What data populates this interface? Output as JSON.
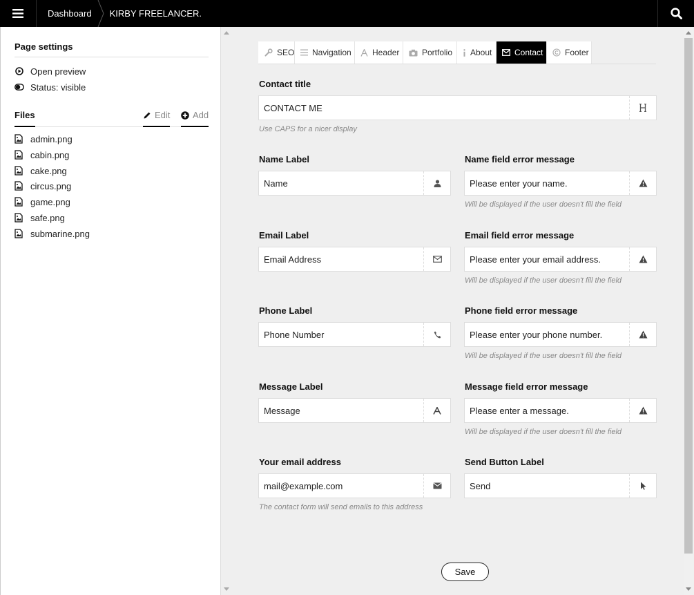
{
  "topbar": {
    "menu_icon": "hamburger-menu-icon",
    "breadcrumb": [
      "Dashboard",
      "KIRBY FREELANCER."
    ],
    "search_icon": "search-icon"
  },
  "sidebar": {
    "page_settings_title": "Page settings",
    "items": [
      {
        "label": "Open preview",
        "icon": "play-circle-icon"
      },
      {
        "label": "Status: visible",
        "icon": "toggle-icon"
      }
    ],
    "files_title": "Files",
    "edit_label": "Edit",
    "add_label": "Add",
    "files": [
      "admin.png",
      "cabin.png",
      "cake.png",
      "circus.png",
      "game.png",
      "safe.png",
      "submarine.png"
    ]
  },
  "tabs": [
    {
      "label": "SEO",
      "icon": "wrench-icon",
      "active": false
    },
    {
      "label": "Navigation",
      "icon": "list-icon",
      "active": false
    },
    {
      "label": "Header",
      "icon": "font-icon",
      "active": false
    },
    {
      "label": "Portfolio",
      "icon": "camera-icon",
      "active": false
    },
    {
      "label": "About",
      "icon": "info-icon",
      "active": false
    },
    {
      "label": "Contact",
      "icon": "envelope-icon",
      "active": true
    },
    {
      "label": "Footer",
      "icon": "copyright-icon",
      "active": false
    }
  ],
  "form": {
    "contact_title": {
      "label": "Contact title",
      "value": "CONTACT ME",
      "help": "Use CAPS for a nicer display"
    },
    "name_label": {
      "label": "Name Label",
      "value": "Name"
    },
    "name_error": {
      "label": "Name field error message",
      "value": "Please enter your name.",
      "help": "Will be displayed if the user doesn't fill the field"
    },
    "email_label": {
      "label": "Email Label",
      "value": "Email Address"
    },
    "email_error": {
      "label": "Email field error message",
      "value": "Please enter your email address.",
      "help": "Will be displayed if the user doesn't fill the field"
    },
    "phone_label": {
      "label": "Phone Label",
      "value": "Phone Number"
    },
    "phone_error": {
      "label": "Phone field error message",
      "value": "Please enter your phone number.",
      "help": "Will be displayed if the user doesn't fill the field"
    },
    "message_label": {
      "label": "Message Label",
      "value": "Message"
    },
    "message_error": {
      "label": "Message field error message",
      "value": "Please enter a message.",
      "help": "Will be displayed if the user doesn't fill the field"
    },
    "your_email": {
      "label": "Your email address",
      "value": "mail@example.com",
      "help": "The contact form will send emails to this address"
    },
    "send_label": {
      "label": "Send Button Label",
      "value": "Send"
    }
  },
  "save_label": "Save"
}
